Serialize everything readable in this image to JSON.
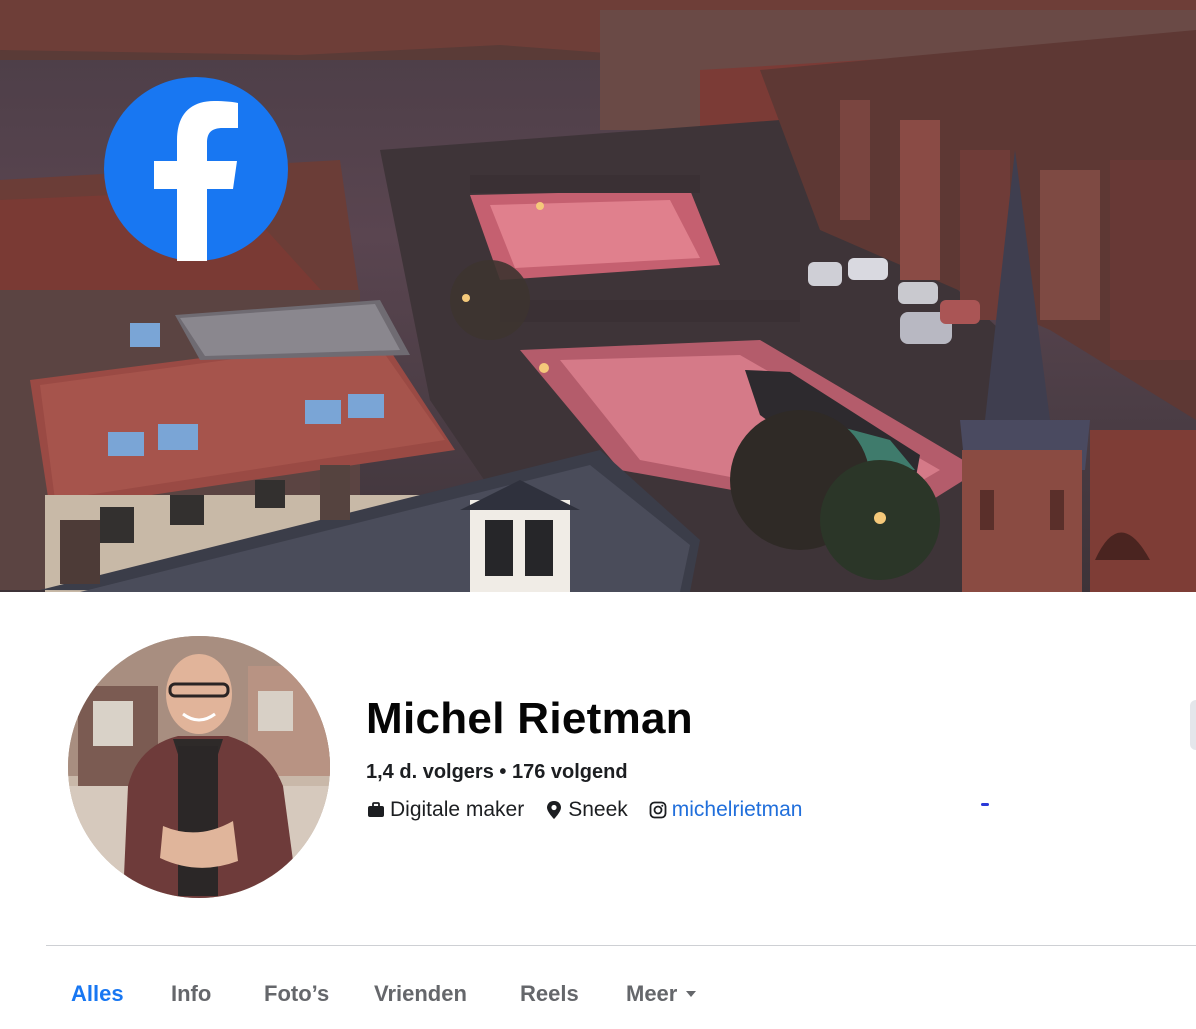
{
  "cover": {
    "logo": "facebook-f-icon"
  },
  "profile": {
    "name": "Michel Rietman",
    "stats": "1,4 d. volgers • 176 volgend",
    "category": "Digitale maker",
    "category_icon": "briefcase-icon",
    "location": "Sneek",
    "location_icon": "map-pin-icon",
    "instagram": "michelrietman",
    "instagram_icon": "instagram-icon"
  },
  "tabs": [
    {
      "label": "Alles",
      "active": true
    },
    {
      "label": "Info"
    },
    {
      "label": "Foto’s"
    },
    {
      "label": "Vrienden"
    },
    {
      "label": "Reels"
    },
    {
      "label": "Meer"
    }
  ],
  "colors": {
    "accent": "#1877f2",
    "link": "#216fdb",
    "muted": "#65676b"
  }
}
